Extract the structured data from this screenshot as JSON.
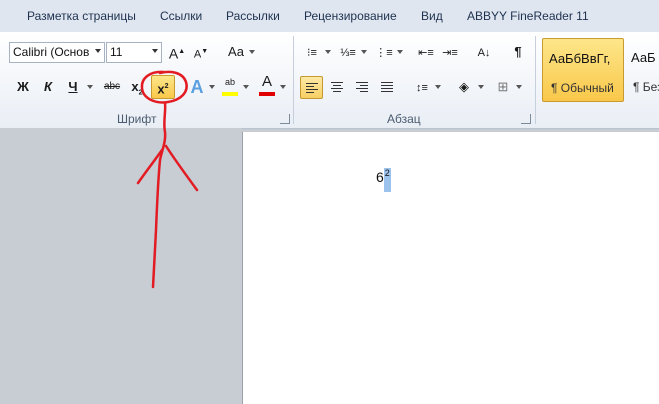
{
  "tabs": [
    "Разметка страницы",
    "Ссылки",
    "Рассылки",
    "Рецензирование",
    "Вид",
    "ABBYY FineReader 11"
  ],
  "font_group": {
    "font_name": "Calibri (Основ",
    "font_size": "11",
    "grow_label": "A",
    "shrink_label": "A",
    "case_label": "Aa",
    "bold_label": "Ж",
    "italic_label": "К",
    "underline_label": "Ч",
    "strike_label": "abc",
    "subscript_label": "x",
    "superscript_label": "x",
    "highlight_label": "ab",
    "font_color_label": "A",
    "group_label": "Шрифт"
  },
  "paragraph_group": {
    "show_marks_label": "¶",
    "group_label": "Абзац"
  },
  "styles_group": {
    "style1_sample": "АаБбВвГг,",
    "style1_name": "¶ Обычный",
    "style2_sample": "АаБ",
    "style2_name": "¶ Без"
  },
  "document": {
    "base_text": "6",
    "superscript_text": "2"
  },
  "colors": {
    "highlight_bar": "#ffff00",
    "font_color_bar": "#e00000",
    "annotation": "#e31b23",
    "selection": "#9cc3ee"
  }
}
